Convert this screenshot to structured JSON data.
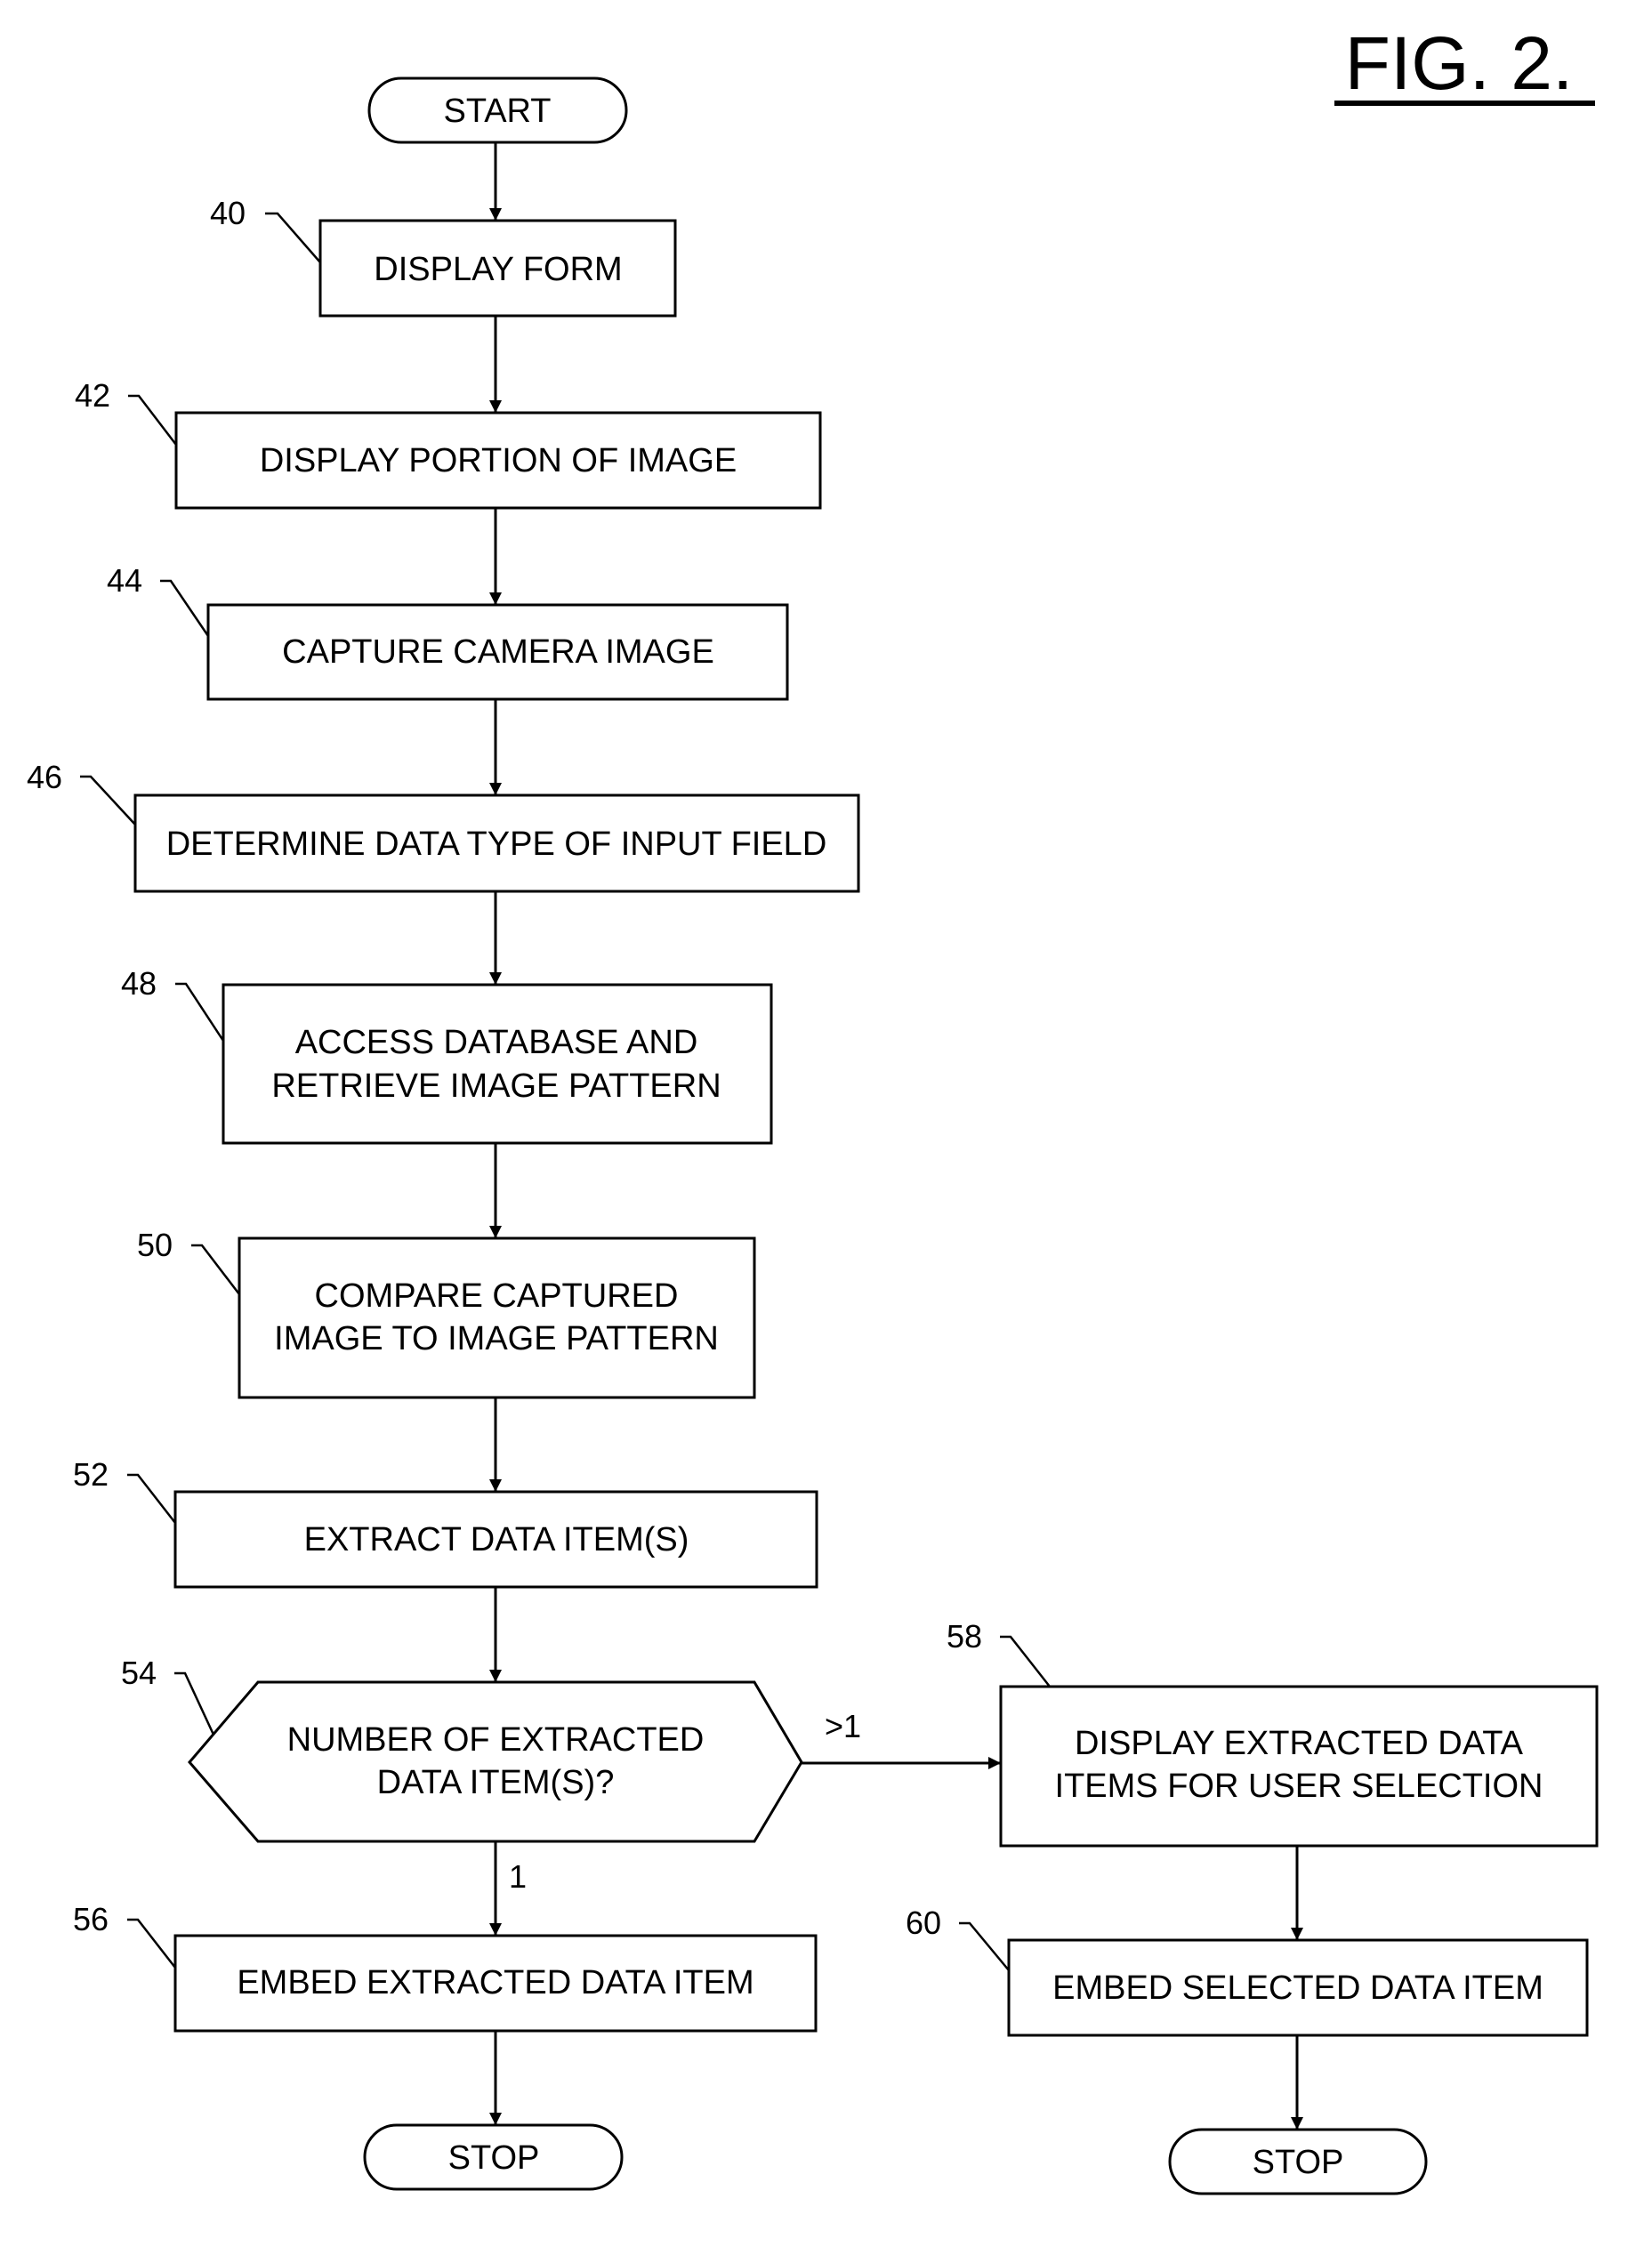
{
  "figure": {
    "title": "FIG. 2."
  },
  "nodes": {
    "start": {
      "label": "START"
    },
    "n40": {
      "ref": "40",
      "lines": [
        "DISPLAY FORM"
      ]
    },
    "n42": {
      "ref": "42",
      "lines": [
        "DISPLAY PORTION OF IMAGE"
      ]
    },
    "n44": {
      "ref": "44",
      "lines": [
        "CAPTURE CAMERA IMAGE"
      ]
    },
    "n46": {
      "ref": "46",
      "lines": [
        "DETERMINE DATA TYPE OF INPUT FIELD"
      ]
    },
    "n48": {
      "ref": "48",
      "lines": [
        "ACCESS DATABASE AND",
        "RETRIEVE IMAGE PATTERN"
      ]
    },
    "n50": {
      "ref": "50",
      "lines": [
        "COMPARE CAPTURED",
        "IMAGE TO IMAGE PATTERN"
      ]
    },
    "n52": {
      "ref": "52",
      "lines": [
        "EXTRACT DATA ITEM(S)"
      ]
    },
    "n54": {
      "ref": "54",
      "lines": [
        "NUMBER OF EXTRACTED",
        "DATA ITEM(S)?"
      ]
    },
    "n56": {
      "ref": "56",
      "lines": [
        "EMBED EXTRACTED DATA ITEM"
      ]
    },
    "n58": {
      "ref": "58",
      "lines": [
        "DISPLAY EXTRACTED DATA",
        "ITEMS FOR USER SELECTION"
      ]
    },
    "n60": {
      "ref": "60",
      "lines": [
        "EMBED SELECTED DATA ITEM"
      ]
    },
    "stop_left": {
      "label": "STOP"
    },
    "stop_right": {
      "label": "STOP"
    }
  },
  "edges": {
    "branch_many": ">1",
    "branch_one": "1"
  }
}
